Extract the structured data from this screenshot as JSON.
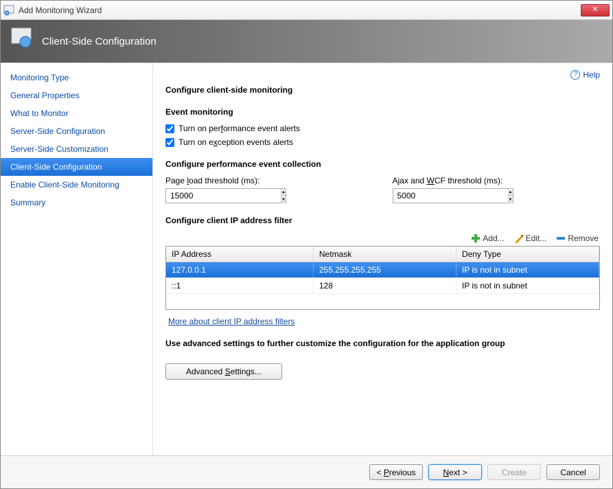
{
  "window": {
    "title": "Add Monitoring Wizard"
  },
  "banner": {
    "title": "Client-Side Configuration"
  },
  "help": {
    "label": "Help"
  },
  "nav": {
    "items": [
      {
        "label": "Monitoring Type"
      },
      {
        "label": "General Properties"
      },
      {
        "label": "What to Monitor"
      },
      {
        "label": "Server-Side Configuration"
      },
      {
        "label": "Server-Side Customization"
      },
      {
        "label": "Client-Side Configuration",
        "selected": true
      },
      {
        "label": "Enable Client-Side Monitoring"
      },
      {
        "label": "Summary"
      }
    ]
  },
  "page": {
    "heading_main": "Configure client-side monitoring",
    "heading_event": "Event monitoring",
    "chk_perf_pre": "Turn on per",
    "chk_perf_u": "f",
    "chk_perf_post": "ormance event alerts",
    "chk_exc_pre": "Turn on e",
    "chk_exc_u": "x",
    "chk_exc_post": "ception events alerts",
    "heading_collection": "Configure performance event collection",
    "label_pageload_pre": "Page ",
    "label_pageload_u": "l",
    "label_pageload_post": "oad threshold (ms):",
    "pageload_value": "15000",
    "label_ajax_pre": "Ajax and ",
    "label_ajax_u": "W",
    "label_ajax_post": "CF threshold (ms):",
    "ajax_value": "5000",
    "heading_ipfilter": "Configure client IP address filter",
    "btn_add": "Add...",
    "btn_edit": "Edit...",
    "btn_remove": "Remove",
    "grid": {
      "cols": [
        "IP Address",
        "Netmask",
        "Deny Type"
      ],
      "rows": [
        {
          "ip": "127.0.0.1",
          "mask": "255.255.255.255",
          "deny": "IP is not in subnet",
          "selected": true
        },
        {
          "ip": "::1",
          "mask": "128",
          "deny": "IP is not in subnet",
          "selected": false
        }
      ]
    },
    "link_more": "More about client IP address filters",
    "heading_advanced": "Use advanced settings to further customize the configuration for the application group",
    "btn_advanced_pre": "Advanced ",
    "btn_advanced_u": "S",
    "btn_advanced_post": "ettings..."
  },
  "footer": {
    "prev_pre": "< ",
    "prev_u": "P",
    "prev_post": "revious",
    "next_pre": "",
    "next_u": "N",
    "next_post": "ext >",
    "create": "Create",
    "cancel": "Cancel"
  }
}
